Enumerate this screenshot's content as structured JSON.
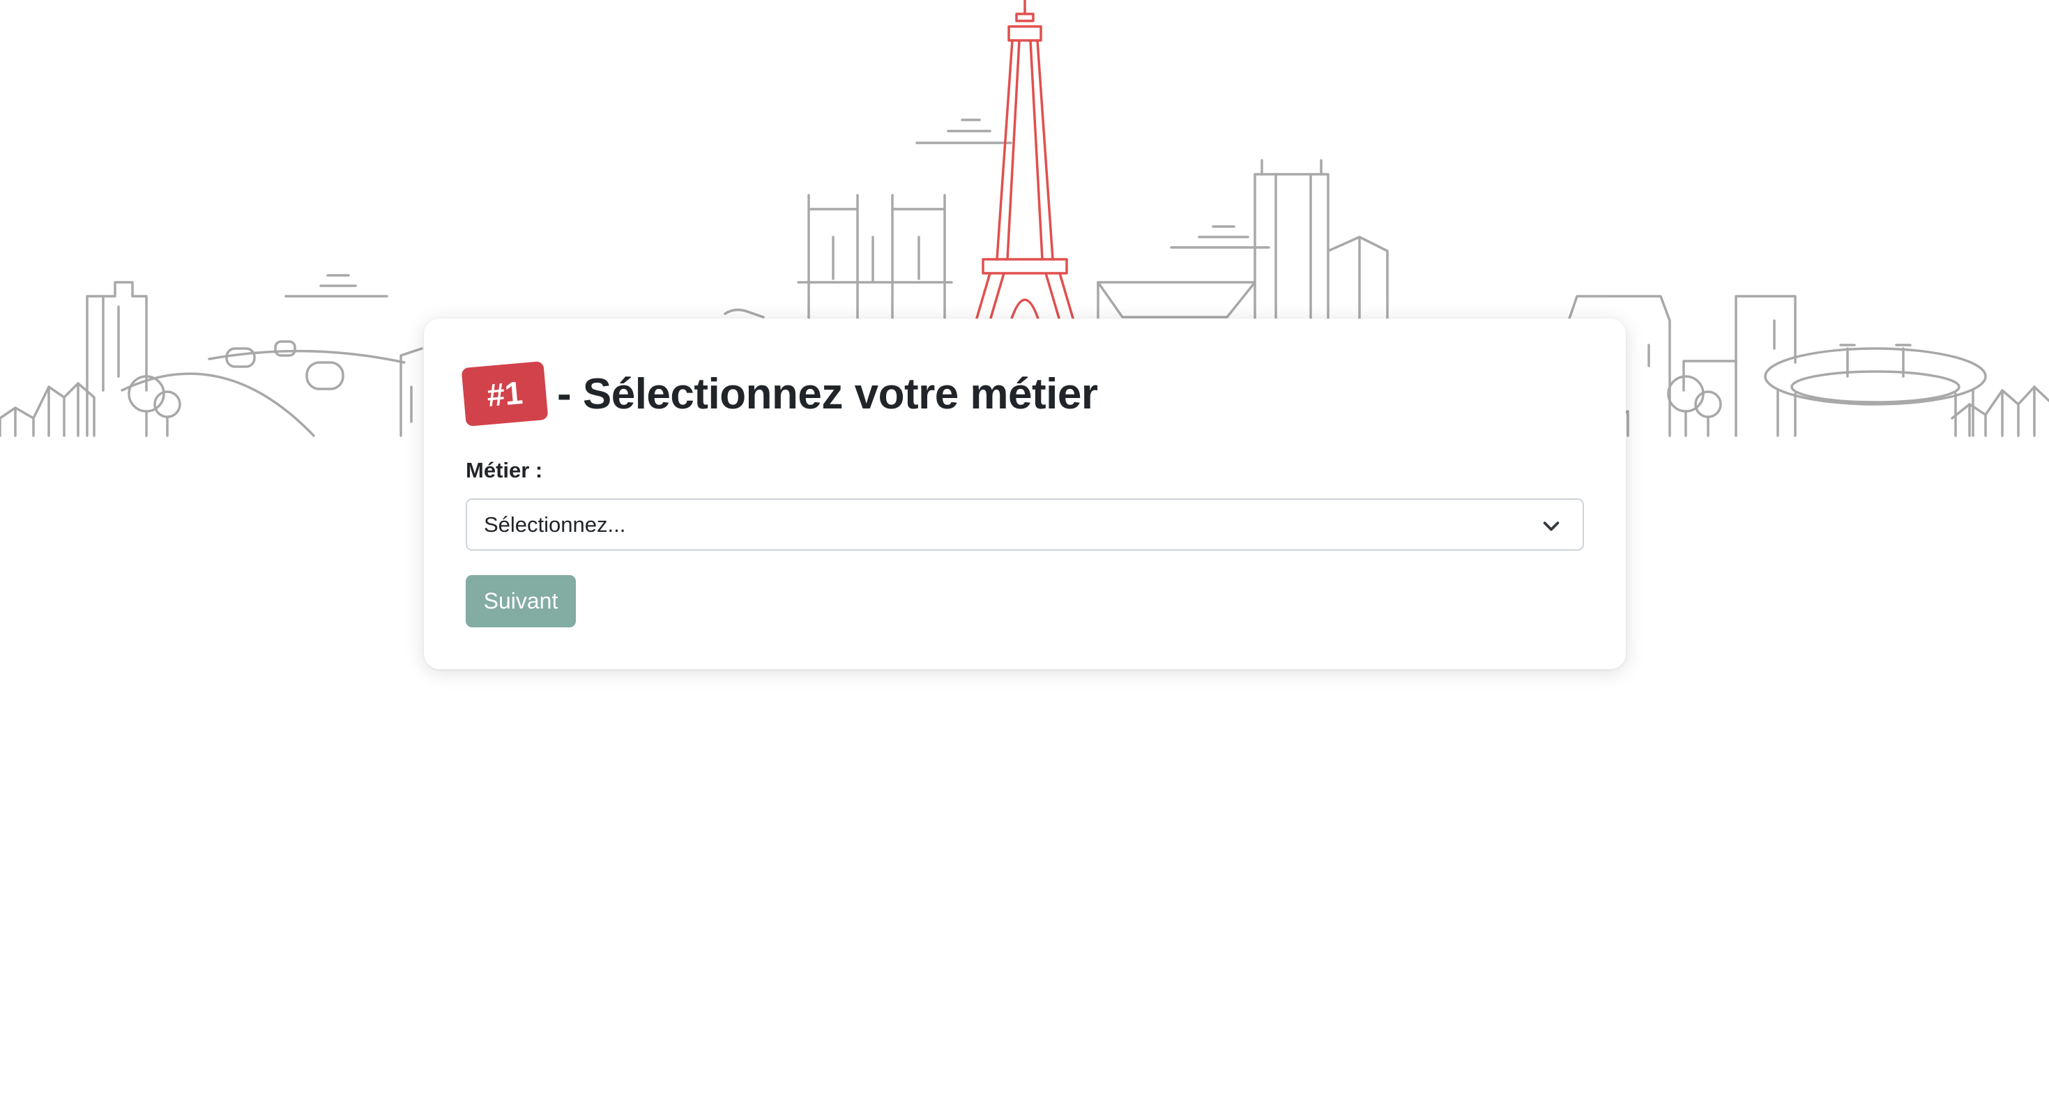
{
  "form": {
    "step_badge": "#1",
    "title": "- Sélectionnez votre métier",
    "field_label": "Métier :",
    "select_value": "Sélectionnez...",
    "next_button": "Suivant"
  },
  "colors": {
    "accent_red": "#d2424b",
    "button_green": "#83aca3",
    "skyline_gray": "#a8a8a8",
    "eiffel_red": "#e0504e"
  },
  "icons": {
    "select": "chevron-down-icon"
  }
}
